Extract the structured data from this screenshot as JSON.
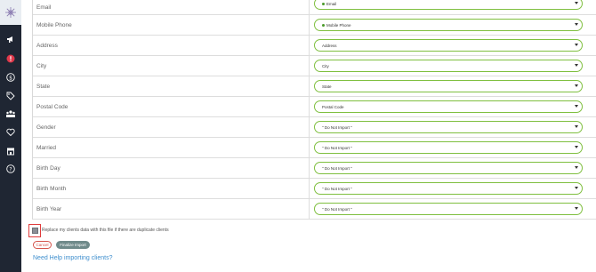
{
  "sidebar": {
    "icons": [
      "logo-icon",
      "megaphone-icon",
      "alert-icon",
      "dollar-icon",
      "tag-icon",
      "group-icon",
      "heart-icon",
      "store-icon",
      "help-icon"
    ],
    "accent": "#e0384a"
  },
  "mapping": {
    "rows": [
      {
        "label": "Email",
        "value": "Email",
        "selected": true
      },
      {
        "label": "Mobile Phone",
        "value": "Mobile Phone",
        "selected": true
      },
      {
        "label": "Address",
        "value": "Address",
        "selected": false
      },
      {
        "label": "City",
        "value": "City",
        "selected": false
      },
      {
        "label": "State",
        "value": "State",
        "selected": false
      },
      {
        "label": "Postal Code",
        "value": "Postal Code",
        "selected": false
      },
      {
        "label": "Gender",
        "value": "\" Do Not Import \"",
        "selected": false
      },
      {
        "label": "Married",
        "value": "\" Do Not Import \"",
        "selected": false
      },
      {
        "label": "Birth Day",
        "value": "\" Do Not Import \"",
        "selected": false
      },
      {
        "label": "Birth Month",
        "value": "\" Do Not Import \"",
        "selected": false
      },
      {
        "label": "Birth Year",
        "value": "\" Do Not Import \"",
        "selected": false
      }
    ]
  },
  "replace_duplicates": {
    "label": "Replace my clients data with this file if there are duplicate clients",
    "checked": false
  },
  "buttons": {
    "cancel": "Cancel",
    "finalize": "Finalize Import"
  },
  "help_link": "Need Help importing clients?",
  "colors": {
    "select_border": "#7fbf3f",
    "sidebar_bg": "#1f2633",
    "link": "#3f8fce",
    "cancel": "#d5534a",
    "finalize": "#6f8a8a"
  }
}
